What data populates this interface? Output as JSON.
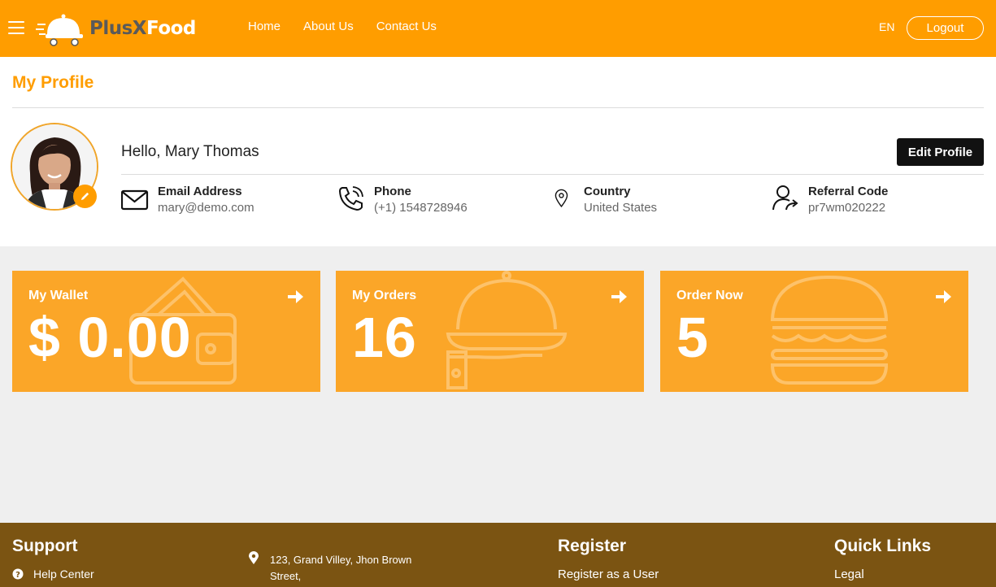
{
  "header": {
    "brand_part1": "PlusX",
    "brand_part2": "Food",
    "nav": [
      "Home",
      "About Us",
      "Contact Us"
    ],
    "language": "EN",
    "logout_label": "Logout"
  },
  "profile": {
    "page_title": "My Profile",
    "greeting": "Hello, Mary Thomas",
    "edit_label": "Edit Profile",
    "info": [
      {
        "label": "Email Address",
        "value": "mary@demo.com",
        "icon": "envelope-icon"
      },
      {
        "label": "Phone",
        "value": "(+1) 1548728946",
        "icon": "phone-icon"
      },
      {
        "label": "Country",
        "value": "United States",
        "icon": "map-pin-icon"
      },
      {
        "label": "Referral Code",
        "value": "pr7wm020222",
        "icon": "user-share-icon"
      }
    ]
  },
  "cards": [
    {
      "title": "My Wallet",
      "value": "$ 0.00",
      "icon": "wallet-icon"
    },
    {
      "title": "My Orders",
      "value": "16",
      "icon": "cloche-icon"
    },
    {
      "title": "Order Now",
      "value": "5",
      "icon": "burger-icon"
    }
  ],
  "footer": {
    "support_heading": "Support",
    "help_center": "Help Center",
    "address": "123, Grand Villey, Jhon Brown Street,",
    "register_heading": "Register",
    "register_user": "Register as a User",
    "quick_links_heading": "Quick Links",
    "legal": "Legal"
  },
  "colors": {
    "brand": "#ff9d00",
    "card": "#fba628",
    "footer": "#7b5412"
  }
}
